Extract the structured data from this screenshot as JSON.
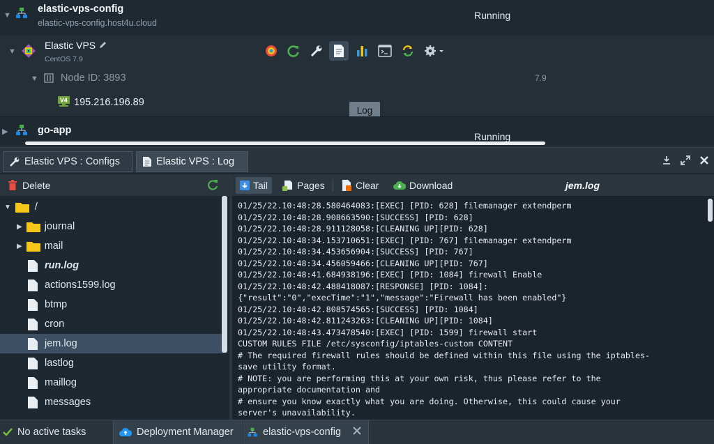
{
  "environments": [
    {
      "name": "elastic-vps-config",
      "domain": "elastic-vps-config.host4u.cloud",
      "status": "Running"
    },
    {
      "name": "go-app",
      "status": "Running"
    }
  ],
  "node_group": {
    "name": "Elastic VPS",
    "os": "CentOS 7.9",
    "node_id": "Node ID: 3893",
    "version": "7.9",
    "ip": "195.216.196.89",
    "ip_badge": "V4"
  },
  "tooltip": "Log",
  "tabs": [
    {
      "label": "Elastic VPS : Configs"
    },
    {
      "label": "Elastic VPS : Log"
    }
  ],
  "tree": {
    "delete_label": "Delete",
    "root": "/",
    "items": [
      {
        "label": "journal",
        "type": "folder"
      },
      {
        "label": "mail",
        "type": "folder"
      },
      {
        "label": "run.log",
        "type": "file"
      },
      {
        "label": "actions1599.log",
        "type": "file"
      },
      {
        "label": "btmp",
        "type": "file"
      },
      {
        "label": "cron",
        "type": "file"
      },
      {
        "label": "jem.log",
        "type": "file",
        "selected": true
      },
      {
        "label": "lastlog",
        "type": "file"
      },
      {
        "label": "maillog",
        "type": "file"
      },
      {
        "label": "messages",
        "type": "file"
      }
    ]
  },
  "log_toolbar": {
    "tail": "Tail",
    "pages": "Pages",
    "clear": "Clear",
    "download": "Download",
    "filename": "jem.log"
  },
  "log_lines": [
    "01/25/22.10:48:28.580464083:[EXEC] [PID: 628] filemanager extendperm",
    "01/25/22.10:48:28.908663590:[SUCCESS] [PID: 628]",
    "01/25/22.10:48:28.911128058:[CLEANING UP][PID: 628]",
    "01/25/22.10:48:34.153710651:[EXEC] [PID: 767] filemanager extendperm",
    "01/25/22.10:48:34.453656904:[SUCCESS] [PID: 767]",
    "01/25/22.10:48:34.456059466:[CLEANING UP][PID: 767]",
    "01/25/22.10:48:41.684938196:[EXEC] [PID: 1084] firewall Enable",
    "01/25/22.10:48:42.488418087:[RESPONSE] [PID: 1084]:",
    "{\"result\":\"0\",\"execTime\":\"1\",\"message\":\"Firewall has been enabled\"}",
    "01/25/22.10:48:42.808574565:[SUCCESS] [PID: 1084]",
    "01/25/22.10:48:42.811243263:[CLEANING UP][PID: 1084]",
    "01/25/22.10:48:43.473478540:[EXEC] [PID: 1599] firewall start",
    "CUSTOM RULES FILE /etc/sysconfig/iptables-custom CONTENT",
    "# The required firewall rules should be defined within this file using the iptables-",
    "save utility format.",
    "# NOTE: you are performing this at your own risk, thus please refer to the",
    "appropriate documentation and",
    "# ensure you know exactly what you are doing. Otherwise, this could cause your",
    "server's unavailability."
  ],
  "statusbar": {
    "tasks": "No active tasks",
    "deployment_manager": "Deployment Manager",
    "env_tab": "elastic-vps-config"
  },
  "colors": {
    "accent_green": "#4caf50",
    "folder_yellow": "#f5c518",
    "selection": "#3d5063",
    "link_blue": "#1e88e5"
  },
  "icons": [
    "chevron-down-icon",
    "environment-icon",
    "centos-icon",
    "pencil-icon",
    "node-icon",
    "network-icon",
    "open-in-browser-icon",
    "restart-icon",
    "config-wrench-icon",
    "log-icon",
    "statistics-icon",
    "web-ssh-icon",
    "redeploy-icon",
    "settings-gear-icon",
    "folder-icon",
    "file-icon",
    "trash-icon",
    "refresh-icon",
    "download-icon",
    "expand-icon",
    "close-icon",
    "check-icon",
    "cloud-icon"
  ]
}
